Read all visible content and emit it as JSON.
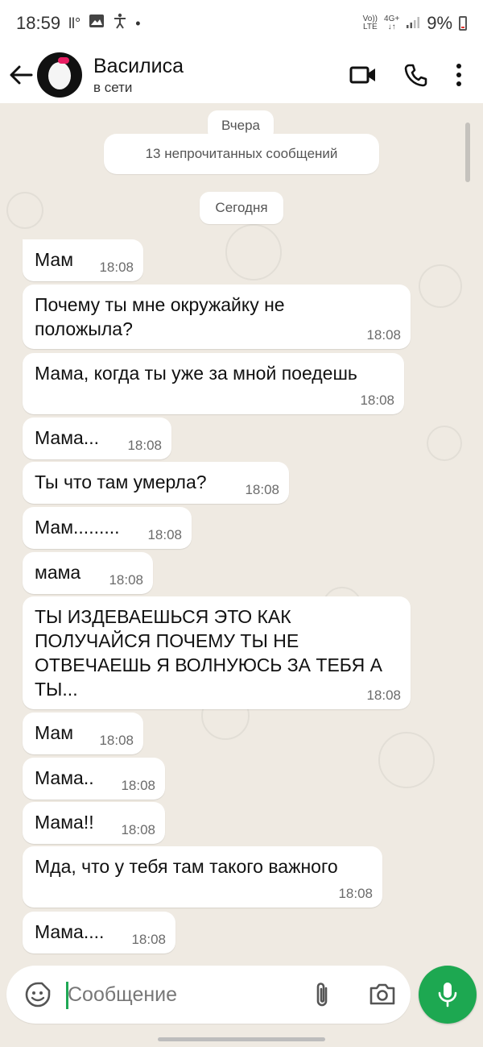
{
  "status_bar": {
    "time": "18:59",
    "notif_icons": "ll°",
    "dot": "•",
    "volte_top": "Vo))",
    "volte_bottom": "LTE",
    "net_top": "4G+",
    "net_bottom": "↓↑",
    "battery": "9%"
  },
  "header": {
    "contact_name": "Василиса",
    "contact_status": "в сети"
  },
  "chat": {
    "date_yesterday": "Вчера",
    "unread_banner": "13 непрочитанных сообщений",
    "date_today": "Сегодня",
    "messages": [
      {
        "text": "Мам",
        "time": "18:08"
      },
      {
        "text": "Почему ты мне окружайку не положыла?",
        "time": "18:08"
      },
      {
        "text": "Мама, когда ты уже за мной поедешь",
        "time": "18:08"
      },
      {
        "text": "Мама...",
        "time": "18:08"
      },
      {
        "text": "Ты что там умерла?",
        "time": "18:08"
      },
      {
        "text": "Мам.........",
        "time": "18:08"
      },
      {
        "text": "мама",
        "time": "18:08"
      },
      {
        "text": "ТЫ ИЗДЕВАЕШЬСЯ ЭТО КАК ПОЛУЧАЙСЯ ПОЧЕМУ ТЫ НЕ ОТВЕЧАЕШЬ Я ВОЛНУЮСЬ ЗА ТЕБЯ А ТЫ...",
        "time": "18:08"
      },
      {
        "text": "Мам",
        "time": "18:08"
      },
      {
        "text": "Мама..",
        "time": "18:08"
      },
      {
        "text": "Мама!!",
        "time": "18:08"
      },
      {
        "text": "Мда, что у тебя там такого важного",
        "time": "18:08"
      },
      {
        "text": "Мама....",
        "time": "18:08"
      }
    ]
  },
  "input_bar": {
    "placeholder": "Сообщение"
  },
  "colors": {
    "accent": "#1da851",
    "chat_background": "#efeae2",
    "bubble": "#ffffff",
    "timestamp": "#6b6b6b"
  },
  "icons": [
    "back-arrow-icon",
    "video-call-icon",
    "phone-icon",
    "more-vert-icon",
    "emoji-icon",
    "attach-icon",
    "camera-icon",
    "mic-icon",
    "gallery-icon",
    "accessibility-icon"
  ]
}
